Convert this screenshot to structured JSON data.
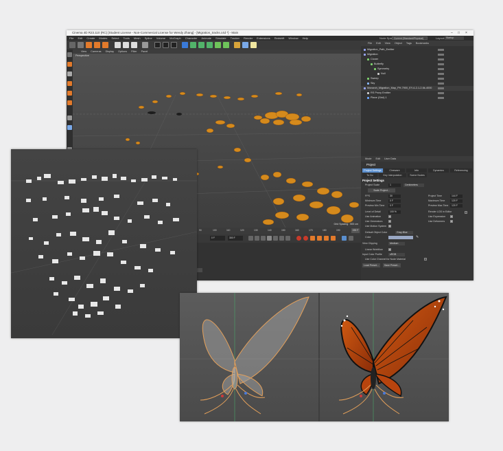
{
  "window": {
    "title": "Cinema 4D R23.110 (RC) [Student License - Non-Commercial License for Wendy Zhang] - [Migration_tracks.c4d *] - Main",
    "controls": [
      "–",
      "□",
      "×"
    ]
  },
  "menubar": {
    "items": [
      "File",
      "Edit",
      "Create",
      "Modes",
      "Select",
      "Tools",
      "Mesh",
      "Spline",
      "Volume",
      "MoGraph",
      "Character",
      "Animate",
      "Simulate",
      "Tracker",
      "Render",
      "Extensions",
      "Redshift",
      "Window",
      "Help"
    ],
    "node_space_label": "Node Space:",
    "node_space_value": "Current (Standard/Physical)",
    "layout_label": "Layout:",
    "layout_value": "Startup"
  },
  "viewport": {
    "menu": [
      "View",
      "Cameras",
      "Display",
      "Options",
      "Filter",
      "Panel"
    ],
    "label": "Perspective",
    "grid_info": "Grid Spacing : 500 cm"
  },
  "timeline": {
    "ticks": [
      "0",
      "10",
      "20",
      "30",
      "40",
      "50",
      "60",
      "70",
      "80",
      "90",
      "100",
      "110",
      "120",
      "130",
      "140",
      "150",
      "160",
      "170",
      "180",
      "190"
    ],
    "end_frame": "190 F",
    "current_frame": "0 F",
    "min_field": "0 F",
    "max_field": "108 F",
    "max_frame": "300 F"
  },
  "coords": {
    "labels": [
      "X",
      "Y",
      "Z"
    ],
    "col_units": [
      "0 cm",
      "0 cm",
      "0 cm"
    ],
    "size_label": "Size",
    "rot_labels": [
      "H",
      "P",
      "B"
    ],
    "dropdown_left": "World",
    "dropdown_mid": "Scale",
    "apply": "Apply"
  },
  "object_manager": {
    "menu": [
      "File",
      "Edit",
      "View",
      "Object",
      "Tags",
      "Bookmarks"
    ],
    "rows": [
      {
        "name": "Migration_Path_Emitter",
        "indent": 0,
        "color": "#9aa8ff"
      },
      {
        "name": "Migration",
        "indent": 0,
        "color": "#9aa8ff"
      },
      {
        "name": "Cloner",
        "indent": 1,
        "color": "#7fd36f"
      },
      {
        "name": "Butterfly",
        "indent": 2,
        "color": "#7fd36f"
      },
      {
        "name": "Symmetry",
        "indent": 3,
        "color": "#7fd36f"
      },
      {
        "name": "Null",
        "indent": 4,
        "color": "#cccccc"
      },
      {
        "name": "Sweep",
        "indent": 1,
        "color": "#7fd36f"
      },
      {
        "name": "Sky",
        "indent": 1,
        "color": "#8ab8ff"
      },
      {
        "name": "Monarch_Migration_Map_PH-7900_EY-4-2-1-2-6k-4000",
        "indent": 0,
        "color": "#9aa8ff"
      },
      {
        "name": "RS Proxy Emitter",
        "indent": 1,
        "color": "#cccccc"
      },
      {
        "name": "Plane (Grid) 1",
        "indent": 1,
        "color": "#6aa6ff"
      }
    ]
  },
  "attribute_manager": {
    "menu": [
      "Mode",
      "Edit",
      "User Data"
    ],
    "object_name": "Project",
    "tabs_row1": [
      "Project Settings",
      "Cineware",
      "Info",
      "Dynamics",
      "Referencing"
    ],
    "tabs_row2": [
      "To Do",
      "Key Interpolation",
      "Scene Nodes"
    ],
    "section": "Project Settings",
    "project_scale_label": "Project Scale",
    "project_scale_value": "1",
    "project_scale_unit": "Centimeters",
    "scale_project_btn": "Scale Project...",
    "fps_label": "FPS",
    "fps_value": "30",
    "project_time_label": "Project Time",
    "project_time_value": "144 F",
    "min_time_label": "Minimum Time",
    "min_time_value": "0 F",
    "max_time_label": "Maximum Time",
    "max_time_value": "120 F",
    "preview_min_label": "Preview Min Time",
    "preview_min_value": "0 F",
    "preview_max_label": "Preview Max Time",
    "preview_max_value": "120 F",
    "lod_label": "Level of Detail",
    "lod_value": "100 %",
    "render_lod_label": "Render LOD in Editor",
    "use_anim_label": "Use Animation",
    "use_expr_label": "Use Expression",
    "use_gen_label": "Use Generators",
    "use_deform_label": "Use Deformers",
    "use_motion_label": "Use Motion System",
    "default_color_label": "Default Object Color",
    "default_color_value": "Gray-Blue",
    "color_label": "Color",
    "view_clip_label": "View Clipping",
    "view_clip_value": "Medium",
    "linear_wf_label": "Linear Workflow",
    "input_color_label": "Input Color Profile",
    "input_color_value": "sRGB",
    "use_color_channel_label": "Use Color Channel for Node Material",
    "load_preset_btn": "Load Preset...",
    "save_preset_btn": "Save Preset..."
  }
}
